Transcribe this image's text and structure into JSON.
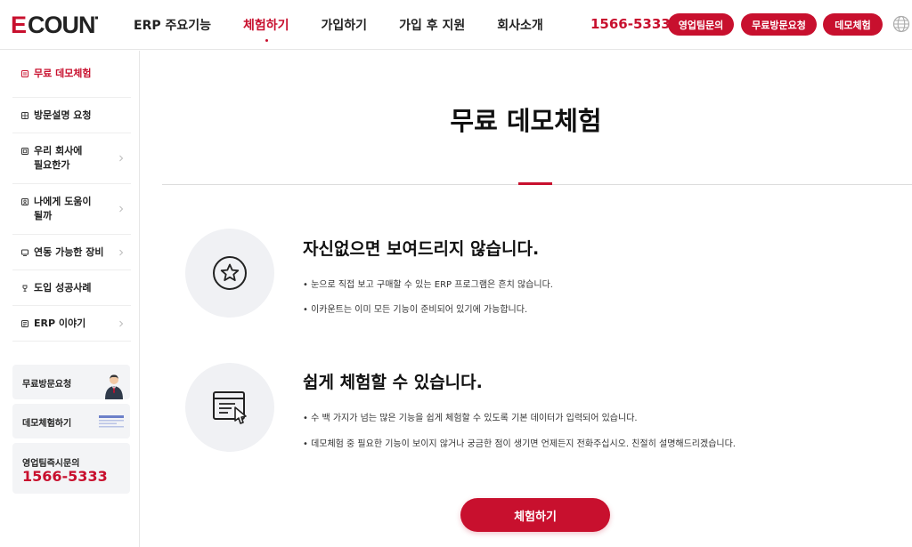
{
  "brand": {
    "logo_text": "ECOUNT",
    "accent_color": "#c8102e"
  },
  "gnb": {
    "items": [
      {
        "label": "ERP 주요기능",
        "active": false
      },
      {
        "label": "체험하기",
        "active": true
      },
      {
        "label": "가입하기",
        "active": false
      },
      {
        "label": "가입 후 지원",
        "active": false
      },
      {
        "label": "회사소개",
        "active": false
      }
    ]
  },
  "header": {
    "phone": "1566-5333",
    "buttons": [
      "영업팀문의",
      "무료방문요청",
      "데모체험"
    ],
    "globe_icon": "globe-icon"
  },
  "sidebar": {
    "items": [
      {
        "label": "무료 데모체험",
        "icon": "demo-icon",
        "active": true,
        "chevron": false
      },
      {
        "label": "방문설명 요청",
        "icon": "visit-icon",
        "active": false,
        "chevron": false
      },
      {
        "label": "우리 회사에\n필요한가",
        "line1": "우리 회사에",
        "line2": "필요한가",
        "icon": "company-icon",
        "active": false,
        "chevron": true
      },
      {
        "label": "나에게 도움이\n될까",
        "line1": "나에게 도움이",
        "line2": "될까",
        "icon": "person-icon",
        "active": false,
        "chevron": true
      },
      {
        "label": "연동 가능한 장비",
        "icon": "device-icon",
        "active": false,
        "chevron": true
      },
      {
        "label": "도입 성공사례",
        "icon": "trophy-icon",
        "active": false,
        "chevron": false
      },
      {
        "label": "ERP 이야기",
        "icon": "book-icon",
        "active": false,
        "chevron": true
      }
    ],
    "cards": {
      "visit": "무료방문요청",
      "demo": "데모체험하기",
      "sales_label": "영업팀즉시문의",
      "sales_phone": "1566-5333"
    }
  },
  "main": {
    "title": "무료 데모체험",
    "features": [
      {
        "icon": "star-icon",
        "title": "자신없으면 보여드리지 않습니다.",
        "bullets": [
          "• 눈으로 직접 보고 구매할 수 있는 ERP 프로그램은 흔치 않습니다.",
          "• 이카운트는 이미 모든 기능이 준비되어 있기에 가능합니다."
        ]
      },
      {
        "icon": "document-click-icon",
        "title": "쉽게 체험할 수 있습니다.",
        "bullets": [
          "• 수 백 가지가 넘는 많은 기능을 쉽게 체험할 수 있도록 기본 데이터가 입력되어 있습니다.",
          "• 데모체험 중 필요한 기능이 보이지 않거나 궁금한 점이 생기면 언제든지 전화주십시오. 친절히 설명해드리겠습니다."
        ]
      }
    ],
    "cta_label": "체험하기"
  }
}
